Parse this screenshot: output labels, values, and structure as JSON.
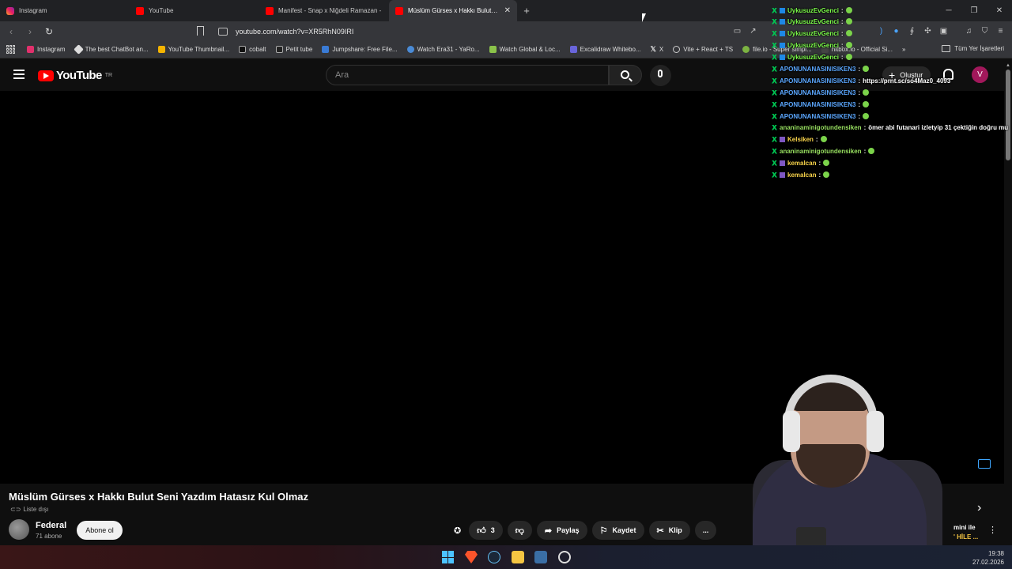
{
  "browser": {
    "tabs": [
      {
        "label": "Instagram",
        "icon": "instagram-icon"
      },
      {
        "label": "YouTube",
        "icon": "youtube-icon"
      },
      {
        "label": "Manifest - Snap x Niğdeli Ramazan -",
        "icon": "youtube-icon"
      },
      {
        "label": "Müslüm Gürses x Hakkı Bulut Sen",
        "icon": "youtube-icon",
        "active": true
      }
    ],
    "url": "youtube.com/watch?v=XR5RhN09IRI",
    "bookmarks": [
      "Instagram",
      "The best ChatBot an...",
      "YouTube Thumbnail...",
      "cobalt",
      "Petit tube",
      "Jumpshare: Free File...",
      "Watch Era31 - YaRo...",
      "Watch Global & Loc...",
      "Excalidraw Whitebo...",
      "X",
      "Vite + React + TS",
      "file.io - Super simpl...",
      "hitbox.io - Official Si..."
    ],
    "bookmarks_more": "»",
    "all_bookmarks": "Tüm Yer İşaretleri"
  },
  "youtube": {
    "logo": "YouTube",
    "region": "TR",
    "search_placeholder": "Ara",
    "create_label": "Oluştur",
    "avatar_letter": "V",
    "video_title": "Müslüm Gürses x Hakkı Bulut Seni Yazdım Hatasız Kul Olmaz",
    "visibility": "Liste dışı",
    "channel_name": "Federal",
    "subscribers": "71 abone",
    "subscribe_label": "Abone ol",
    "like_count": "3",
    "share_label": "Paylaş",
    "save_label": "Kaydet",
    "clip_label": "Klip",
    "more_label": "...",
    "side_text_1": "mini ile",
    "side_text_2": "' HİLE ..."
  },
  "chat": [
    {
      "user": "UykusuzEvGenci",
      "sep": ":",
      "text": "",
      "color": "green",
      "emote": true
    },
    {
      "user": "UykusuzEvGenci",
      "sep": ":",
      "text": "",
      "color": "green",
      "emote": true
    },
    {
      "user": "UykusuzEvGenci",
      "sep": ":",
      "text": "",
      "color": "green",
      "emote": true
    },
    {
      "user": "UykusuzEvGenci",
      "sep": ":",
      "text": "",
      "color": "green",
      "emote": true
    },
    {
      "user": "UykusuzEvGenci",
      "sep": ":",
      "text": "",
      "color": "green",
      "emote": true
    },
    {
      "user": "APONUNANASINISIKEN3",
      "sep": ":",
      "text": "",
      "color": "blue",
      "emote": true
    },
    {
      "user": "APONUNANASINISIKEN3",
      "sep": ":",
      "text": "https://prnt.sc/so4Maz0_4093",
      "color": "blue",
      "emote": false
    },
    {
      "user": "APONUNANASINISIKEN3",
      "sep": ":",
      "text": "",
      "color": "blue",
      "emote": true
    },
    {
      "user": "APONUNANASINISIKEN3",
      "sep": ":",
      "text": "",
      "color": "blue",
      "emote": true
    },
    {
      "user": "APONUNANASINISIKEN3",
      "sep": ":",
      "text": "",
      "color": "blue",
      "emote": true
    },
    {
      "user": "ananinaminigotundensiken",
      "sep": ":",
      "text": "ömer abi futanari izletyip 31 çektiğin doğru mu",
      "color": "lightgreen",
      "emote": false
    },
    {
      "user": "Kelsiken",
      "sep": ":",
      "text": "",
      "color": "yellow",
      "emote": true
    },
    {
      "user": "ananinaminigotundensiken",
      "sep": ":",
      "text": "",
      "color": "lightgreen",
      "emote": true
    },
    {
      "user": "kemalcan",
      "sep": ":",
      "text": "",
      "color": "yellow",
      "emote": true
    },
    {
      "user": "kemalcan",
      "sep": ":",
      "text": "",
      "color": "yellow",
      "emote": true
    }
  ],
  "taskbar": {
    "time": "19:38",
    "date": "27.02.2026"
  },
  "colors": {
    "yt_red": "#ff0000",
    "bg": "#0f0f0f",
    "chat_green": "#7cfc4a",
    "chat_blue": "#5ba7ff"
  }
}
